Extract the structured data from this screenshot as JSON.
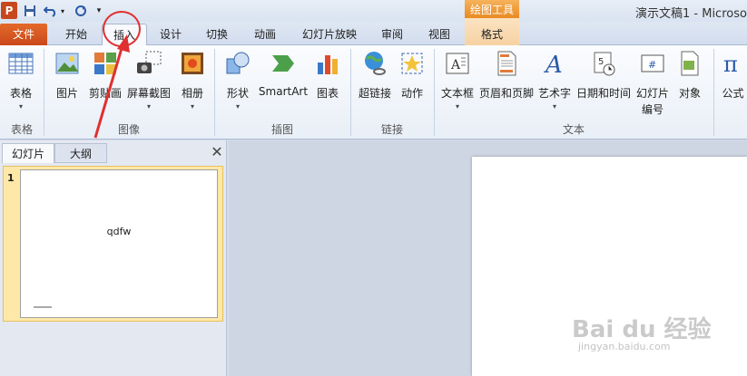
{
  "title_bar": {
    "app_logo": "P",
    "document_title": "演示文稿1 - Microsof",
    "contextual_tools": "绘图工具",
    "qat_icons": [
      "save-icon",
      "undo-icon",
      "redo-icon",
      "customize-qat-icon"
    ]
  },
  "tabs": {
    "file": "文件",
    "home": "开始",
    "insert": "插入",
    "design": "设计",
    "transitions": "切换",
    "animations": "动画",
    "slideshow": "幻灯片放映",
    "review": "审阅",
    "view": "视图",
    "format": "格式"
  },
  "ribbon": {
    "groups": {
      "tables": "表格",
      "images": "图像",
      "illustrations": "插图",
      "links": "链接",
      "text": "文本"
    },
    "commands": {
      "table": "表格",
      "picture": "图片",
      "clipart": "剪贴画",
      "screenshot": "屏幕截图",
      "album": "相册",
      "shapes": "形状",
      "smartart": "SmartArt",
      "chart": "图表",
      "hyperlink": "超链接",
      "action": "动作",
      "textbox": "文本框",
      "header_footer": "页眉和页脚",
      "wordart": "艺术字",
      "datetime": "日期和时间",
      "slide_number_l1": "幻灯片",
      "slide_number_l2": "编号",
      "object": "对象",
      "equation": "公式"
    }
  },
  "left_panel": {
    "tab_slides": "幻灯片",
    "tab_outline": "大纲",
    "close": "✕",
    "slide_number": "1",
    "slide_text": "qdfw"
  },
  "watermark": {
    "main": "Bai du 经验",
    "url": "jingyan.baidu.com"
  },
  "colors": {
    "file_tab": "#c9481a",
    "tools_accent": "#e98a22",
    "annotation": "#e03030",
    "selected_thumb": "#fde8a8"
  }
}
